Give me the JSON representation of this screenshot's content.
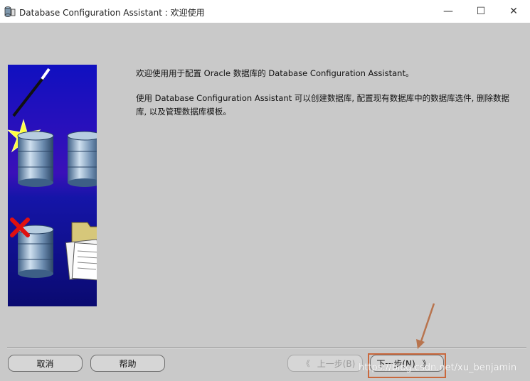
{
  "window": {
    "title": "Database Configuration Assistant : 欢迎使用",
    "minimize_glyph": "—",
    "maximize_glyph": "☐",
    "close_glyph": "✕"
  },
  "content": {
    "welcome_text": "欢迎使用用于配置 Oracle 数据库的 Database Configuration Assistant。",
    "description_text": "使用 Database Configuration Assistant 可以创建数据库, 配置现有数据库中的数据库选件, 删除数据库, 以及管理数据库模板。"
  },
  "buttons": {
    "cancel": "取消",
    "help": "帮助",
    "back": "上一步(B)",
    "next": "下一步(N)",
    "back_arrow": "《",
    "next_arrow": "》"
  },
  "watermark": "https://blog.csdn.net/xu_benjamin",
  "colors": {
    "background": "#c9c9c9",
    "highlight_box": "#c9683d",
    "side_image_blue": "#1a1aa8"
  }
}
